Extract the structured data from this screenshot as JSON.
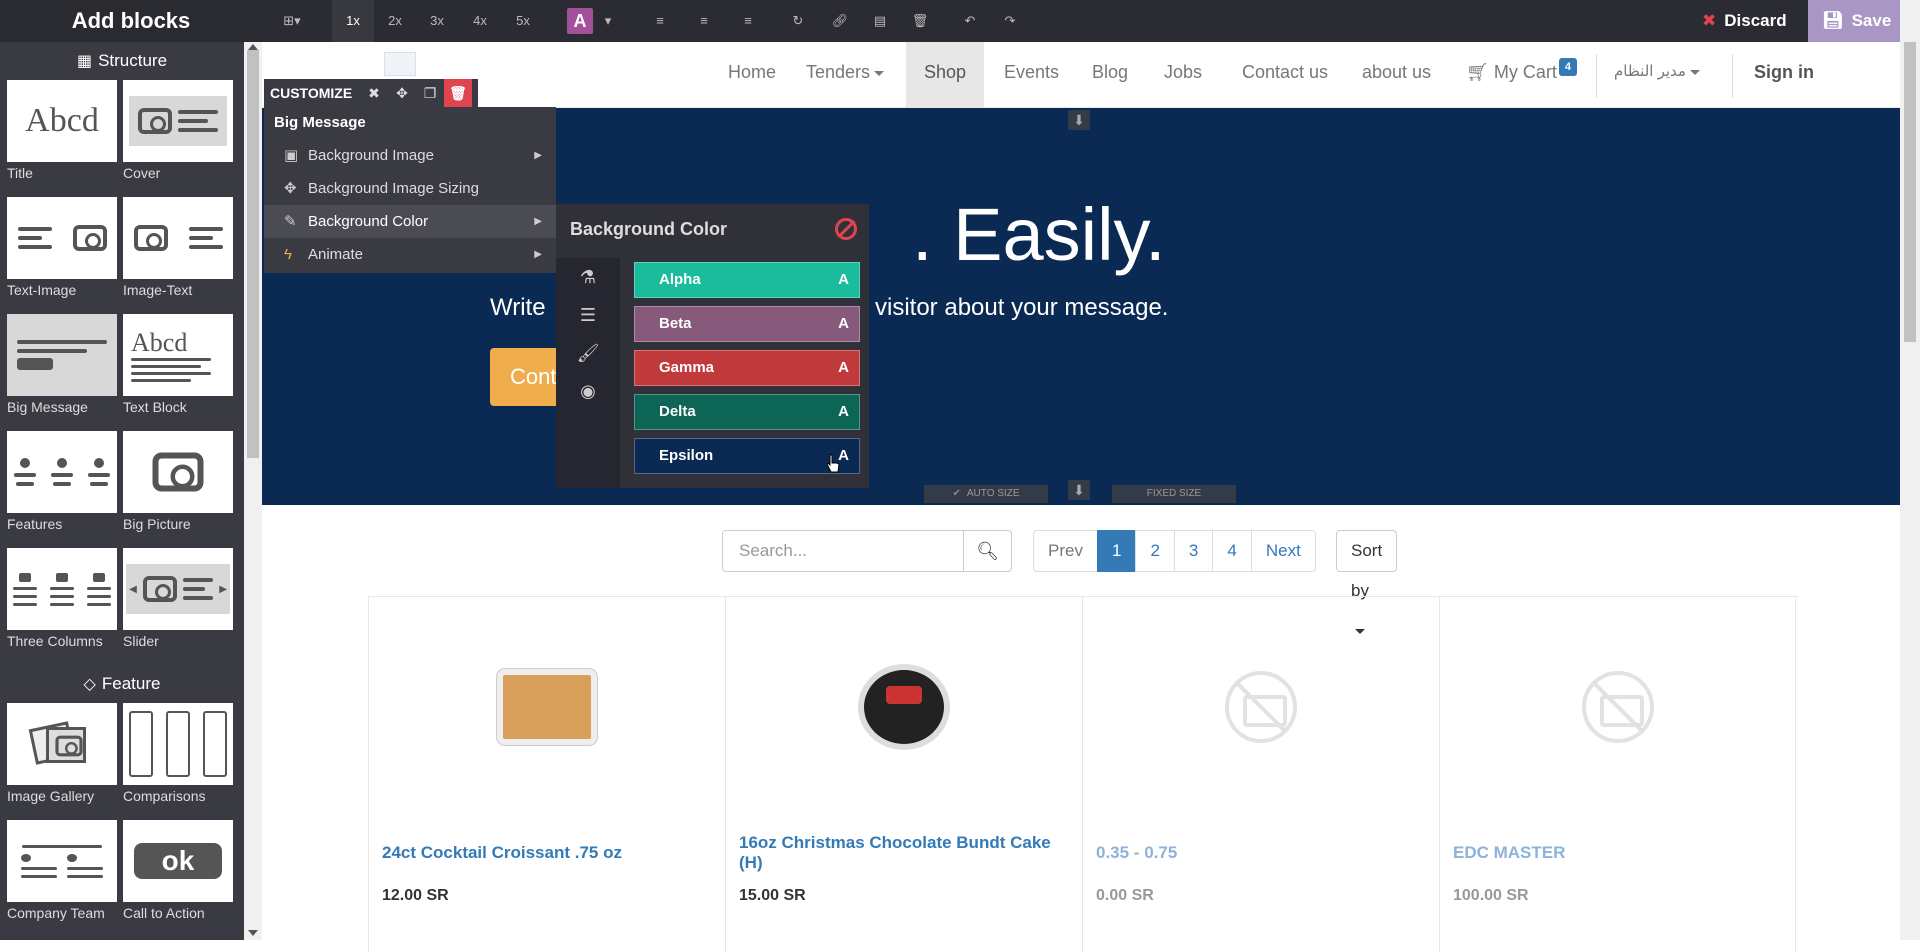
{
  "sidebar": {
    "title": "Add blocks",
    "structure_title": "Structure",
    "feature_title": "Feature",
    "structure_blocks": [
      {
        "label": "Title"
      },
      {
        "label": "Cover"
      },
      {
        "label": "Text-Image"
      },
      {
        "label": "Image-Text"
      },
      {
        "label": "Big Message"
      },
      {
        "label": "Text Block"
      },
      {
        "label": "Features"
      },
      {
        "label": "Big Picture"
      },
      {
        "label": "Three Columns"
      },
      {
        "label": "Slider"
      }
    ],
    "feature_blocks": [
      {
        "label": "Image Gallery"
      },
      {
        "label": "Comparisons"
      },
      {
        "label": "Company Team"
      },
      {
        "label": "Call to Action"
      }
    ],
    "thumb_text": {
      "abcd": "Abcd",
      "ok": "ok"
    }
  },
  "toolbar": {
    "zoom": [
      "1x",
      "2x",
      "3x",
      "4x",
      "5x"
    ],
    "zoom_active": "1x",
    "font_letter": "A",
    "discard_label": "Discard",
    "save_label": "Save"
  },
  "navbar": {
    "items": [
      "Home",
      "Tenders",
      "Shop",
      "Events",
      "Blog",
      "Jobs",
      "Contact us",
      "about us"
    ],
    "active": "Shop",
    "cart_label": "My Cart",
    "cart_count": "4",
    "user_label": "مدير النظام",
    "signin_label": "Sign in"
  },
  "banner": {
    "title_visible": ". Easily.",
    "subtitle_left": "Write",
    "subtitle_right": "visitor about your message.",
    "cta_visible": "Cont",
    "auto_size": "AUTO SIZE",
    "fixed_size": "FIXED SIZE",
    "color": "#0b2a53"
  },
  "customize": {
    "label": "CUSTOMIZE",
    "menu_title": "Big Message",
    "items": [
      {
        "label": "Background Image",
        "icon": "image-icon",
        "has_submenu": true
      },
      {
        "label": "Background Image Sizing",
        "icon": "move-icon",
        "has_submenu": false
      },
      {
        "label": "Background Color",
        "icon": "eyedropper-icon",
        "has_submenu": true
      },
      {
        "label": "Animate",
        "icon": "bolt-icon",
        "has_submenu": true
      }
    ],
    "active_item": "Background Color"
  },
  "bg_panel": {
    "title": "Background Color",
    "tabs": [
      "flask-icon",
      "database-icon",
      "brush-icon",
      "eye-slash-icon"
    ],
    "swatches": [
      {
        "name": "Alpha",
        "letter": "A",
        "color": "#1abc9c"
      },
      {
        "name": "Beta",
        "letter": "A",
        "color": "#875a7b"
      },
      {
        "name": "Gamma",
        "letter": "A",
        "color": "#c0393b"
      },
      {
        "name": "Delta",
        "letter": "A",
        "color": "#0d6655"
      },
      {
        "name": "Epsilon",
        "letter": "A",
        "color": "#0b2a53"
      }
    ]
  },
  "shop": {
    "search_placeholder": "Search...",
    "pager": {
      "prev": "Prev",
      "pages": [
        "1",
        "2",
        "3",
        "4"
      ],
      "active": "1",
      "next": "Next"
    },
    "sort_label": "Sort by",
    "products": [
      {
        "name": "24ct Cocktail Croissant .75 oz",
        "price": "12.00 SR",
        "image": "croissant"
      },
      {
        "name": "16oz Christmas Chocolate Bundt Cake (H)",
        "price": "15.00 SR",
        "image": "cake"
      },
      {
        "name": "0.35 - 0.75",
        "price": "0.00 SR",
        "image": "no-photo"
      },
      {
        "name": "EDC MASTER",
        "price": "100.00 SR",
        "image": "no-photo"
      }
    ]
  }
}
